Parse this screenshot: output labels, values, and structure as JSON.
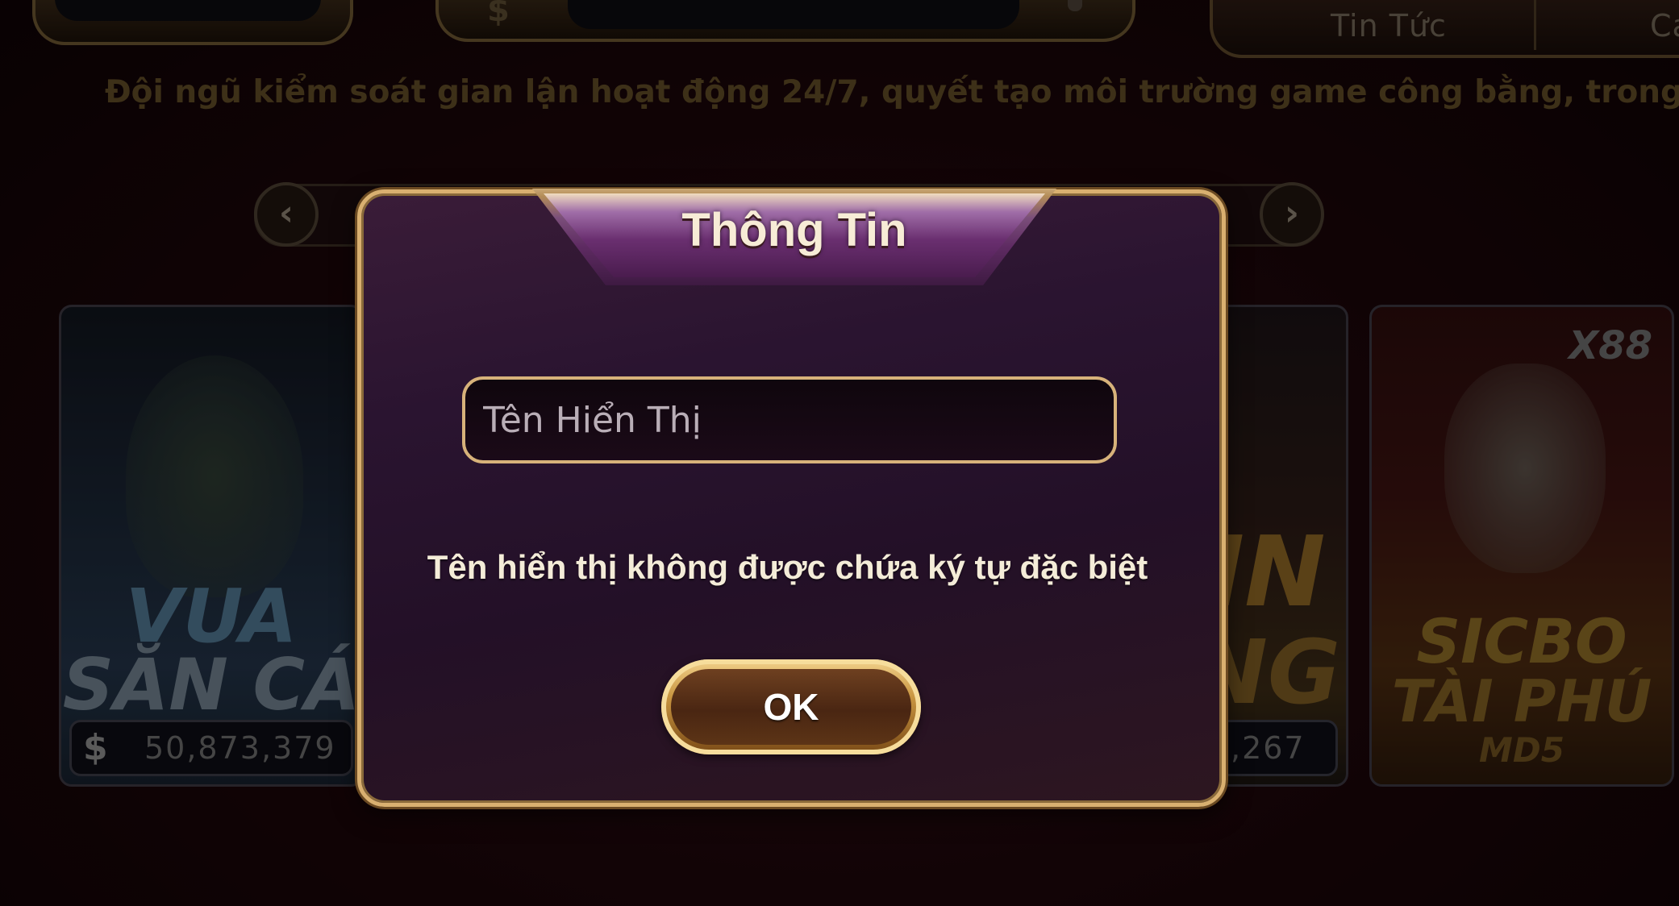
{
  "top_bar": {
    "tab_news": "Tin Tức",
    "tab_partial": "Cá"
  },
  "marquee_text": "Đội ngũ kiểm soát gian lận hoạt động 24/7, quyết tạo môi trường game công bằng, trong sạch.",
  "pager": {
    "prev_icon": "chevron-left-icon",
    "next_icon": "chevron-right-icon"
  },
  "games": [
    {
      "title_line1": "VUA",
      "title_line2": "SĂN CÁ",
      "jackpot": "50,873,379"
    },
    {
      "title_partial_1": "IN",
      "title_partial_2": "NG",
      "jackpot": ",267"
    },
    {
      "badge": "X88",
      "title_line1": "SICBO",
      "title_line2": "TÀI PHÚ",
      "title_line3": "MD5"
    }
  ],
  "dialog": {
    "title": "Thông Tin",
    "input_placeholder": "Tên Hiển Thị",
    "message": "Tên hiển thị không được chứa ký tự đặc biệt",
    "ok_label": "OK"
  },
  "colors": {
    "gold": "#d9b070",
    "dialog_purple": "#2a1430",
    "text_cream": "#f4ecd8"
  }
}
